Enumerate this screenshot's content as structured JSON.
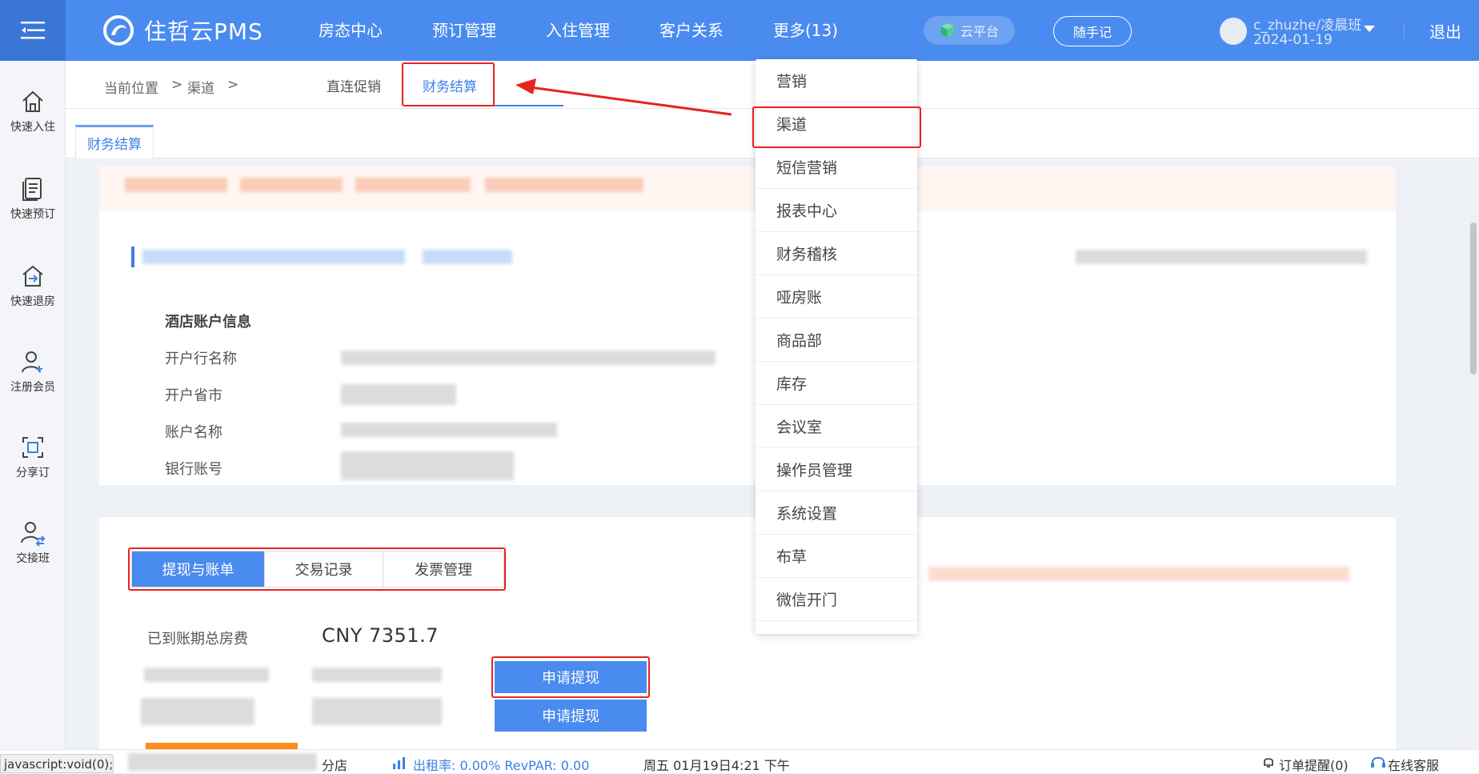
{
  "app": {
    "name": "住哲云PMS"
  },
  "topnav": [
    {
      "label": "房态中心"
    },
    {
      "label": "预订管理"
    },
    {
      "label": "入住管理"
    },
    {
      "label": "客户关系"
    },
    {
      "label": "更多(13)"
    }
  ],
  "header": {
    "cloud_label": "云平台",
    "note_label": "随手记",
    "user_name": "c_zhuzhe/凌晨班",
    "user_date": "2024-01-19",
    "logout_label": "退出"
  },
  "sidebar": {
    "items": [
      {
        "label": "快速入住",
        "icon": "home-icon"
      },
      {
        "label": "快速预订",
        "icon": "document-icon"
      },
      {
        "label": "快速退房",
        "icon": "checkout-icon"
      },
      {
        "label": "注册会员",
        "icon": "add-user-icon"
      },
      {
        "label": "分享订",
        "icon": "share-icon"
      },
      {
        "label": "交接班",
        "icon": "handover-icon"
      }
    ]
  },
  "breadcrumb": {
    "current": "当前位置",
    "level1": "渠道",
    "sep": ">"
  },
  "subtabs": [
    {
      "label": "直连促销",
      "active": false
    },
    {
      "label": "财务结算",
      "active": true
    }
  ],
  "pagetab": {
    "label": "财务结算"
  },
  "account_info": {
    "title": "酒店账户信息",
    "fields": [
      {
        "label": "开户行名称"
      },
      {
        "label": "开户省市"
      },
      {
        "label": "账户名称"
      },
      {
        "label": "银行账号"
      }
    ]
  },
  "segment": {
    "tabs": [
      {
        "label": "提现与账单",
        "active": true
      },
      {
        "label": "交易记录",
        "active": false
      },
      {
        "label": "发票管理",
        "active": false
      }
    ]
  },
  "billing": {
    "due_label": "已到账期总房费",
    "due_value": "CNY 7351.7",
    "apply_label_1": "申请提现",
    "apply_label_2": "申请提现"
  },
  "more_menu": {
    "items": [
      "营销",
      "渠道",
      "短信营销",
      "报表中心",
      "财务稽核",
      "哑房账",
      "商品部",
      "库存",
      "会议室",
      "操作员管理",
      "系统设置",
      "布草",
      "微信开门"
    ]
  },
  "statusbar": {
    "js_void": "javascript:void(0);",
    "branch": "分店",
    "occupancy": "出租率: 0.00% RevPAR: 0.00",
    "datetime": "周五 01月19日4:21 下午",
    "order_alert": "订单提醒(0)",
    "online_service": "在线客服"
  },
  "colors": {
    "primary": "#4a8bef",
    "annotation": "#e8231e",
    "orange": "#ff8c1a"
  }
}
